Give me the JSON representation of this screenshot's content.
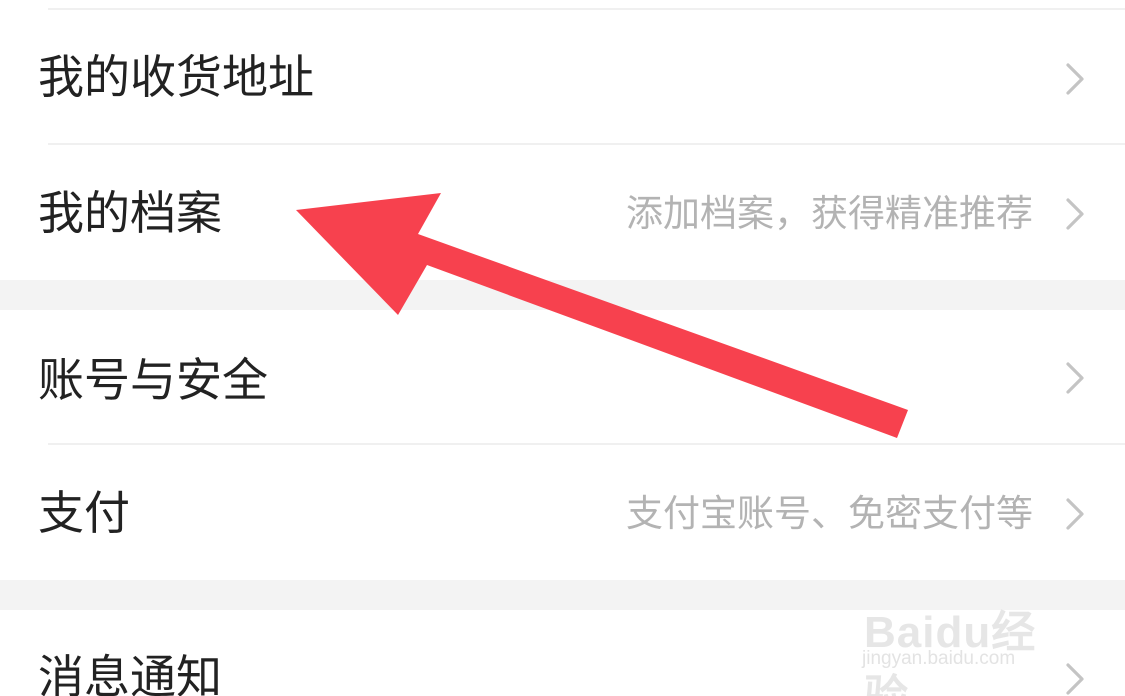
{
  "settings": {
    "items": [
      {
        "label": "我的收货地址",
        "subtitle": ""
      },
      {
        "label": "我的档案",
        "subtitle": "添加档案，获得精准推荐"
      },
      {
        "label": "账号与安全",
        "subtitle": ""
      },
      {
        "label": "支付",
        "subtitle": "支付宝账号、免密支付等"
      },
      {
        "label": "消息通知",
        "subtitle": ""
      }
    ]
  },
  "icons": {
    "chevron": "chevron-right-icon",
    "annotation": "red-arrow-icon"
  },
  "colors": {
    "text_primary": "#222222",
    "text_secondary": "#b3b3b3",
    "chevron": "#c4c4c4",
    "section_gap": "#f3f3f3",
    "arrow": "#f7414e"
  },
  "watermark": {
    "brand": "Baidu经验",
    "url": "jingyan.baidu.com"
  }
}
